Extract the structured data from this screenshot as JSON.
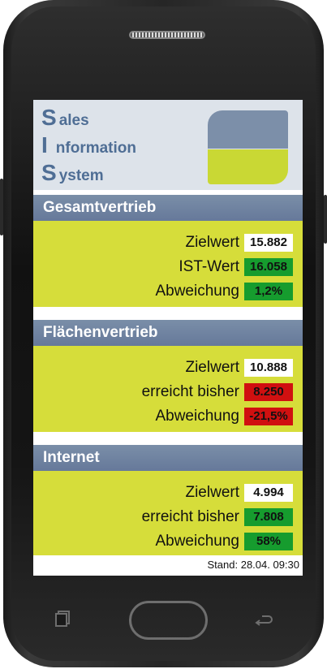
{
  "logo": {
    "line1_cap": "S",
    "line1_rest": "ales",
    "line2_cap": "I",
    "line2_rest": "nformation",
    "line3_cap": "S",
    "line3_rest": "ystem"
  },
  "sections": [
    {
      "title": "Gesamtvertrieb",
      "rows": [
        {
          "label": "Zielwert",
          "value": "15.882",
          "status": "white"
        },
        {
          "label": "IST-Wert",
          "value": "16.058",
          "status": "green"
        },
        {
          "label": "Abweichung",
          "value": "1,2%",
          "status": "green"
        }
      ]
    },
    {
      "title": "Flächenvertrieb",
      "rows": [
        {
          "label": "Zielwert",
          "value": "10.888",
          "status": "white"
        },
        {
          "label": "erreicht bisher",
          "value": "8.250",
          "status": "red"
        },
        {
          "label": "Abweichung",
          "value": "-21,5%",
          "status": "red"
        }
      ]
    },
    {
      "title": "Internet",
      "rows": [
        {
          "label": "Zielwert",
          "value": "4.994",
          "status": "white"
        },
        {
          "label": "erreicht bisher",
          "value": "7.808",
          "status": "green"
        },
        {
          "label": "Abweichung",
          "value": "58%",
          "status": "green"
        }
      ]
    }
  ],
  "footer": {
    "stand": "Stand: 28.04. 09:30"
  },
  "colors": {
    "header_bar": "#7a8ea8",
    "section_body": "#d6dd3a",
    "positive": "#169c2e",
    "negative": "#d01010",
    "logo_text": "#4f6e95"
  },
  "icons": {
    "recent": "recent-apps-icon",
    "home": "home-button",
    "back": "back-icon"
  }
}
